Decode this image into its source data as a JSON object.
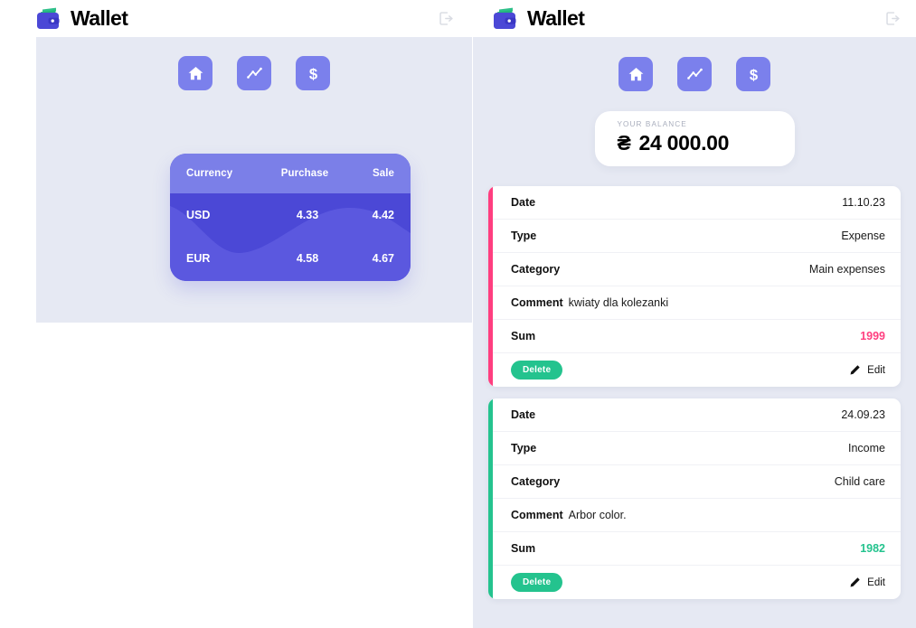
{
  "app": {
    "brand_name": "Wallet",
    "logo_icon": "wallet-icon",
    "logout_icon": "logout-icon",
    "accent_purple": "#4B48D6",
    "accent_purple_light": "#7B7FE8",
    "accent_pink": "#FF3E7F",
    "accent_teal": "#24C38E",
    "panel_background": "#E6E9F3"
  },
  "nav": {
    "items": [
      {
        "icon": "home-icon",
        "label": "Home"
      },
      {
        "icon": "statistics-icon",
        "label": "Statistics"
      },
      {
        "icon": "currency-icon",
        "label": "Currency"
      }
    ]
  },
  "rates": {
    "columns": [
      "Currency",
      "Purchase",
      "Sale"
    ],
    "rows": [
      {
        "currency": "USD",
        "purchase": "4.33",
        "sale": "4.42"
      },
      {
        "currency": "EUR",
        "purchase": "4.58",
        "sale": "4.67"
      }
    ]
  },
  "balance": {
    "label": "YOUR BALANCE",
    "currency_symbol": "₴",
    "amount": "24 000.00"
  },
  "transactions": {
    "labels": {
      "date": "Date",
      "type": "Type",
      "category": "Category",
      "comment": "Comment",
      "sum": "Sum",
      "delete": "Delete",
      "edit": "Edit"
    },
    "items": [
      {
        "date": "11.10.23",
        "type": "Expense",
        "category": "Main expenses",
        "comment": "kwiaty dla kolezanki",
        "sum": "1999",
        "accent": "#FF3E7F"
      },
      {
        "date": "24.09.23",
        "type": "Income",
        "category": "Child care",
        "comment": "Arbor color.",
        "sum": "1982",
        "accent": "#24C38E"
      }
    ]
  }
}
